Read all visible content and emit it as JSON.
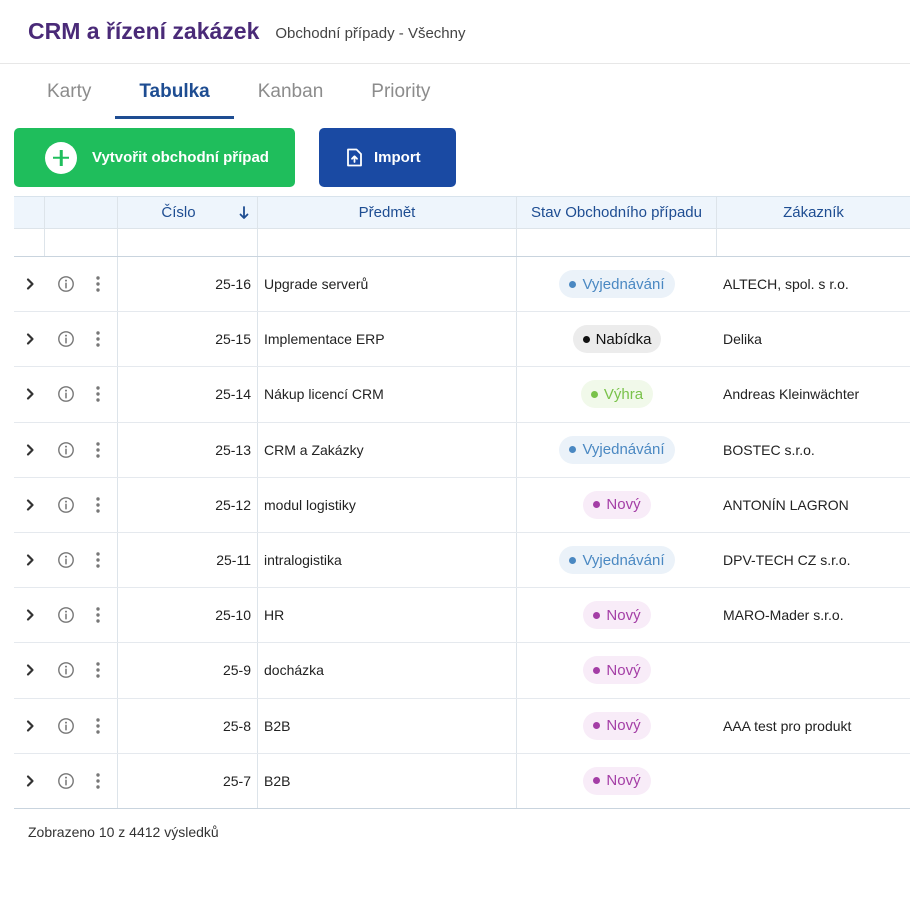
{
  "header": {
    "app_title": "CRM a řízení zakázek",
    "subtitle": "Obchodní případy - Všechny"
  },
  "tabs": [
    {
      "label": "Karty",
      "active": false
    },
    {
      "label": "Tabulka",
      "active": true
    },
    {
      "label": "Kanban",
      "active": false
    },
    {
      "label": "Priority",
      "active": false
    }
  ],
  "toolbar": {
    "create_label": "Vytvořit obchodní případ",
    "import_label": "Import"
  },
  "table": {
    "columns": [
      "Číslo",
      "Předmět",
      "Stav Obchodního případu",
      "Zákazník"
    ],
    "sort_icon": "arrow-down-icon",
    "rows": [
      {
        "number": "25-16",
        "subject": "Upgrade serverů",
        "status": "Vyjednávání",
        "customer": "ALTECH, spol. s r.o."
      },
      {
        "number": "25-15",
        "subject": "Implementace ERP",
        "status": "Nabídka",
        "customer": "Delika"
      },
      {
        "number": "25-14",
        "subject": "Nákup licencí CRM",
        "status": "Výhra",
        "customer": "Andreas Kleinwächter"
      },
      {
        "number": "25-13",
        "subject": "CRM a Zakázky",
        "status": "Vyjednávání",
        "customer": "BOSTEC s.r.o."
      },
      {
        "number": "25-12",
        "subject": "modul logistiky",
        "status": "Nový",
        "customer": "ANTONÍN LAGRON"
      },
      {
        "number": "25-11",
        "subject": "intralogistika",
        "status": "Vyjednávání",
        "customer": "DPV-TECH CZ s.r.o."
      },
      {
        "number": "25-10",
        "subject": "HR",
        "status": "Nový",
        "customer": "MARO-Mader s.r.o."
      },
      {
        "number": "25-9",
        "subject": "docházka",
        "status": "Nový",
        "customer": ""
      },
      {
        "number": "25-8",
        "subject": "B2B",
        "status": "Nový",
        "customer": "AAA test pro produkt"
      },
      {
        "number": "25-7",
        "subject": "B2B",
        "status": "Nový",
        "customer": ""
      }
    ]
  },
  "status_styles": {
    "Vyjednávání": {
      "color": "#4a88c2",
      "background": "#ebf2f9"
    },
    "Nabídka": {
      "color": "#111111",
      "background": "#ececec"
    },
    "Výhra": {
      "color": "#79c24a",
      "background": "#f1f9ea"
    },
    "Nový": {
      "color": "#a43ea6",
      "background": "#f8ecf8"
    }
  },
  "footer": {
    "results_text": "Zobrazeno 10 z 4412 výsledků"
  },
  "colors": {
    "brand_title": "#4a2a78",
    "accent_blue": "#1e4d92",
    "create_button": "#1fbe5c",
    "import_button": "#1a4aa3"
  }
}
